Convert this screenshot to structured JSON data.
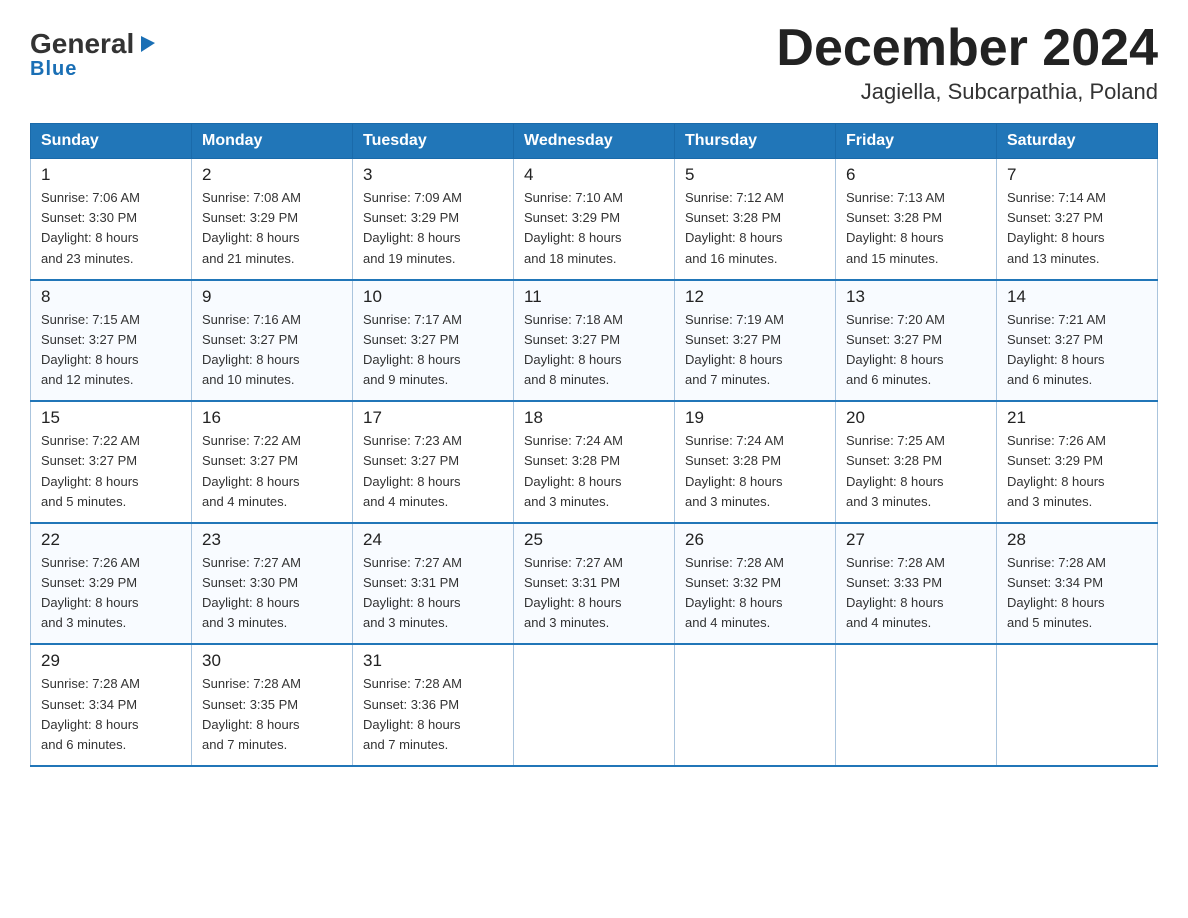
{
  "logo": {
    "text_general": "General",
    "triangle": "▶",
    "text_blue": "Blue"
  },
  "title": "December 2024",
  "subtitle": "Jagiella, Subcarpathia, Poland",
  "headers": [
    "Sunday",
    "Monday",
    "Tuesday",
    "Wednesday",
    "Thursday",
    "Friday",
    "Saturday"
  ],
  "weeks": [
    [
      {
        "day": "1",
        "sunrise": "7:06 AM",
        "sunset": "3:30 PM",
        "daylight": "8 hours and 23 minutes."
      },
      {
        "day": "2",
        "sunrise": "7:08 AM",
        "sunset": "3:29 PM",
        "daylight": "8 hours and 21 minutes."
      },
      {
        "day": "3",
        "sunrise": "7:09 AM",
        "sunset": "3:29 PM",
        "daylight": "8 hours and 19 minutes."
      },
      {
        "day": "4",
        "sunrise": "7:10 AM",
        "sunset": "3:29 PM",
        "daylight": "8 hours and 18 minutes."
      },
      {
        "day": "5",
        "sunrise": "7:12 AM",
        "sunset": "3:28 PM",
        "daylight": "8 hours and 16 minutes."
      },
      {
        "day": "6",
        "sunrise": "7:13 AM",
        "sunset": "3:28 PM",
        "daylight": "8 hours and 15 minutes."
      },
      {
        "day": "7",
        "sunrise": "7:14 AM",
        "sunset": "3:27 PM",
        "daylight": "8 hours and 13 minutes."
      }
    ],
    [
      {
        "day": "8",
        "sunrise": "7:15 AM",
        "sunset": "3:27 PM",
        "daylight": "8 hours and 12 minutes."
      },
      {
        "day": "9",
        "sunrise": "7:16 AM",
        "sunset": "3:27 PM",
        "daylight": "8 hours and 10 minutes."
      },
      {
        "day": "10",
        "sunrise": "7:17 AM",
        "sunset": "3:27 PM",
        "daylight": "8 hours and 9 minutes."
      },
      {
        "day": "11",
        "sunrise": "7:18 AM",
        "sunset": "3:27 PM",
        "daylight": "8 hours and 8 minutes."
      },
      {
        "day": "12",
        "sunrise": "7:19 AM",
        "sunset": "3:27 PM",
        "daylight": "8 hours and 7 minutes."
      },
      {
        "day": "13",
        "sunrise": "7:20 AM",
        "sunset": "3:27 PM",
        "daylight": "8 hours and 6 minutes."
      },
      {
        "day": "14",
        "sunrise": "7:21 AM",
        "sunset": "3:27 PM",
        "daylight": "8 hours and 6 minutes."
      }
    ],
    [
      {
        "day": "15",
        "sunrise": "7:22 AM",
        "sunset": "3:27 PM",
        "daylight": "8 hours and 5 minutes."
      },
      {
        "day": "16",
        "sunrise": "7:22 AM",
        "sunset": "3:27 PM",
        "daylight": "8 hours and 4 minutes."
      },
      {
        "day": "17",
        "sunrise": "7:23 AM",
        "sunset": "3:27 PM",
        "daylight": "8 hours and 4 minutes."
      },
      {
        "day": "18",
        "sunrise": "7:24 AM",
        "sunset": "3:28 PM",
        "daylight": "8 hours and 3 minutes."
      },
      {
        "day": "19",
        "sunrise": "7:24 AM",
        "sunset": "3:28 PM",
        "daylight": "8 hours and 3 minutes."
      },
      {
        "day": "20",
        "sunrise": "7:25 AM",
        "sunset": "3:28 PM",
        "daylight": "8 hours and 3 minutes."
      },
      {
        "day": "21",
        "sunrise": "7:26 AM",
        "sunset": "3:29 PM",
        "daylight": "8 hours and 3 minutes."
      }
    ],
    [
      {
        "day": "22",
        "sunrise": "7:26 AM",
        "sunset": "3:29 PM",
        "daylight": "8 hours and 3 minutes."
      },
      {
        "day": "23",
        "sunrise": "7:27 AM",
        "sunset": "3:30 PM",
        "daylight": "8 hours and 3 minutes."
      },
      {
        "day": "24",
        "sunrise": "7:27 AM",
        "sunset": "3:31 PM",
        "daylight": "8 hours and 3 minutes."
      },
      {
        "day": "25",
        "sunrise": "7:27 AM",
        "sunset": "3:31 PM",
        "daylight": "8 hours and 3 minutes."
      },
      {
        "day": "26",
        "sunrise": "7:28 AM",
        "sunset": "3:32 PM",
        "daylight": "8 hours and 4 minutes."
      },
      {
        "day": "27",
        "sunrise": "7:28 AM",
        "sunset": "3:33 PM",
        "daylight": "8 hours and 4 minutes."
      },
      {
        "day": "28",
        "sunrise": "7:28 AM",
        "sunset": "3:34 PM",
        "daylight": "8 hours and 5 minutes."
      }
    ],
    [
      {
        "day": "29",
        "sunrise": "7:28 AM",
        "sunset": "3:34 PM",
        "daylight": "8 hours and 6 minutes."
      },
      {
        "day": "30",
        "sunrise": "7:28 AM",
        "sunset": "3:35 PM",
        "daylight": "8 hours and 7 minutes."
      },
      {
        "day": "31",
        "sunrise": "7:28 AM",
        "sunset": "3:36 PM",
        "daylight": "8 hours and 7 minutes."
      },
      null,
      null,
      null,
      null
    ]
  ],
  "labels": {
    "sunrise": "Sunrise:",
    "sunset": "Sunset:",
    "daylight": "Daylight:"
  }
}
